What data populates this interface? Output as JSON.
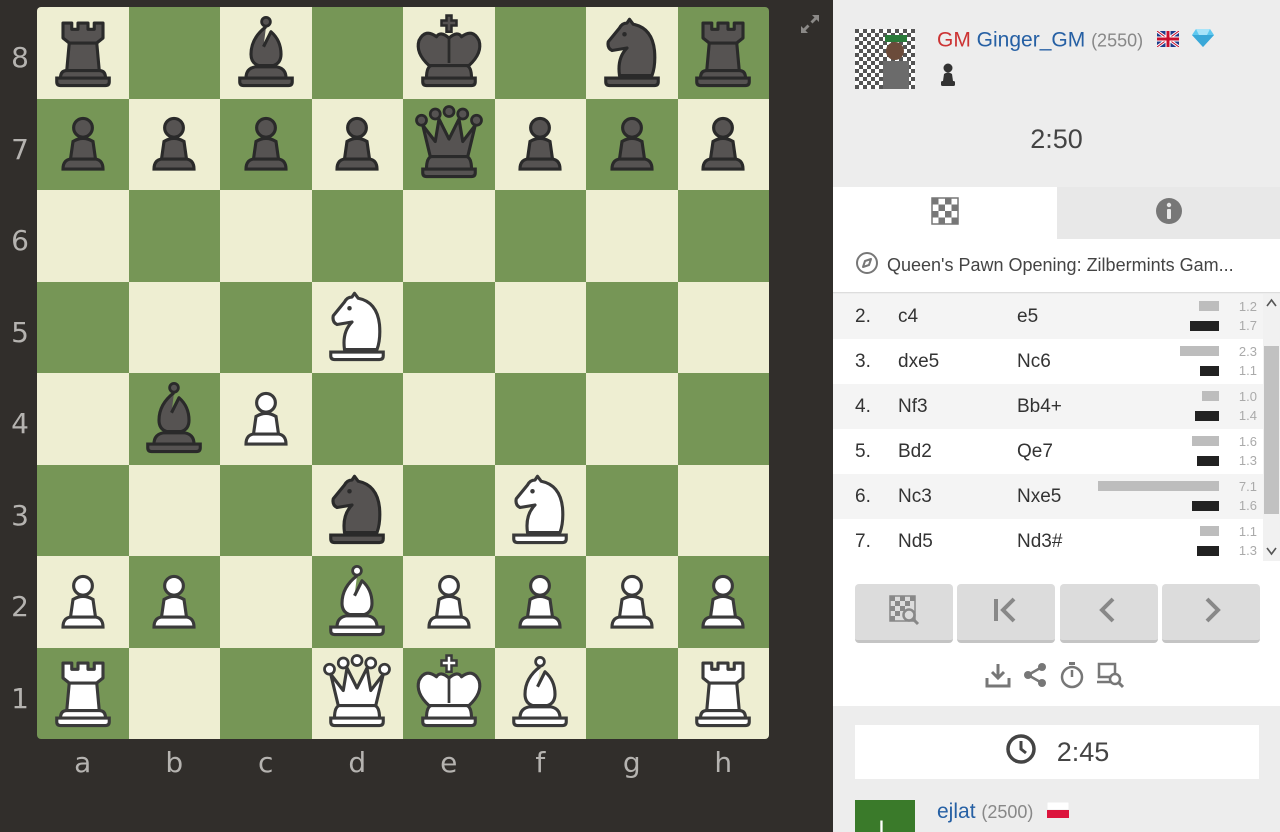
{
  "board": {
    "ranks": [
      "8",
      "7",
      "6",
      "5",
      "4",
      "3",
      "2",
      "1"
    ],
    "files": [
      "a",
      "b",
      "c",
      "d",
      "e",
      "f",
      "g",
      "h"
    ],
    "position": [
      [
        "br",
        "",
        "bb",
        "",
        "bk",
        "",
        "bn",
        "br"
      ],
      [
        "bp",
        "bp",
        "bp",
        "bp",
        "bq",
        "bp",
        "bp",
        "bp"
      ],
      [
        "",
        "",
        "",
        "",
        "",
        "",
        "",
        ""
      ],
      [
        "",
        "",
        "",
        "wn",
        "",
        "",
        "",
        ""
      ],
      [
        "",
        "bb",
        "wp",
        "",
        "",
        "",
        "",
        ""
      ],
      [
        "",
        "",
        "",
        "bn",
        "",
        "wn",
        "",
        ""
      ],
      [
        "wp",
        "wp",
        "",
        "wb",
        "wp",
        "wp",
        "wp",
        "wp"
      ],
      [
        "wr",
        "",
        "",
        "wq",
        "wk",
        "wb",
        "",
        "wr"
      ]
    ]
  },
  "opponent": {
    "title": "GM",
    "username": "Ginger_GM",
    "rating": "(2550)",
    "flag": "gb",
    "clock": "2:50"
  },
  "tabs": {
    "board_icon": "checkered-board-icon",
    "info_icon": "info-icon"
  },
  "opening": {
    "icon": "compass-icon",
    "name": "Queen's Pawn Opening: Zilbermints Gam..."
  },
  "moves": [
    {
      "num": "2.",
      "white": "c4",
      "black": "e5",
      "tw": "1.2",
      "tb": "1.7",
      "w": 1.2,
      "b": 1.7
    },
    {
      "num": "3.",
      "white": "dxe5",
      "black": "Nc6",
      "tw": "2.3",
      "tb": "1.1",
      "w": 2.3,
      "b": 1.1
    },
    {
      "num": "4.",
      "white": "Nf3",
      "black": "Bb4+",
      "tw": "1.0",
      "tb": "1.4",
      "w": 1.0,
      "b": 1.4
    },
    {
      "num": "5.",
      "white": "Bd2",
      "black": "Qe7",
      "tw": "1.6",
      "tb": "1.3",
      "w": 1.6,
      "b": 1.3
    },
    {
      "num": "6.",
      "white": "Nc3",
      "black": "Nxe5",
      "tw": "7.1",
      "tb": "1.6",
      "w": 7.1,
      "b": 1.6
    },
    {
      "num": "7.",
      "white": "Nd5",
      "black": "Nd3#",
      "tw": "1.1",
      "tb": "1.3",
      "w": 1.1,
      "b": 1.3
    }
  ],
  "me": {
    "username": "ejlat",
    "rating": "(2500)",
    "flag": "pl",
    "clock": "2:45",
    "avatar_letter": "L"
  }
}
